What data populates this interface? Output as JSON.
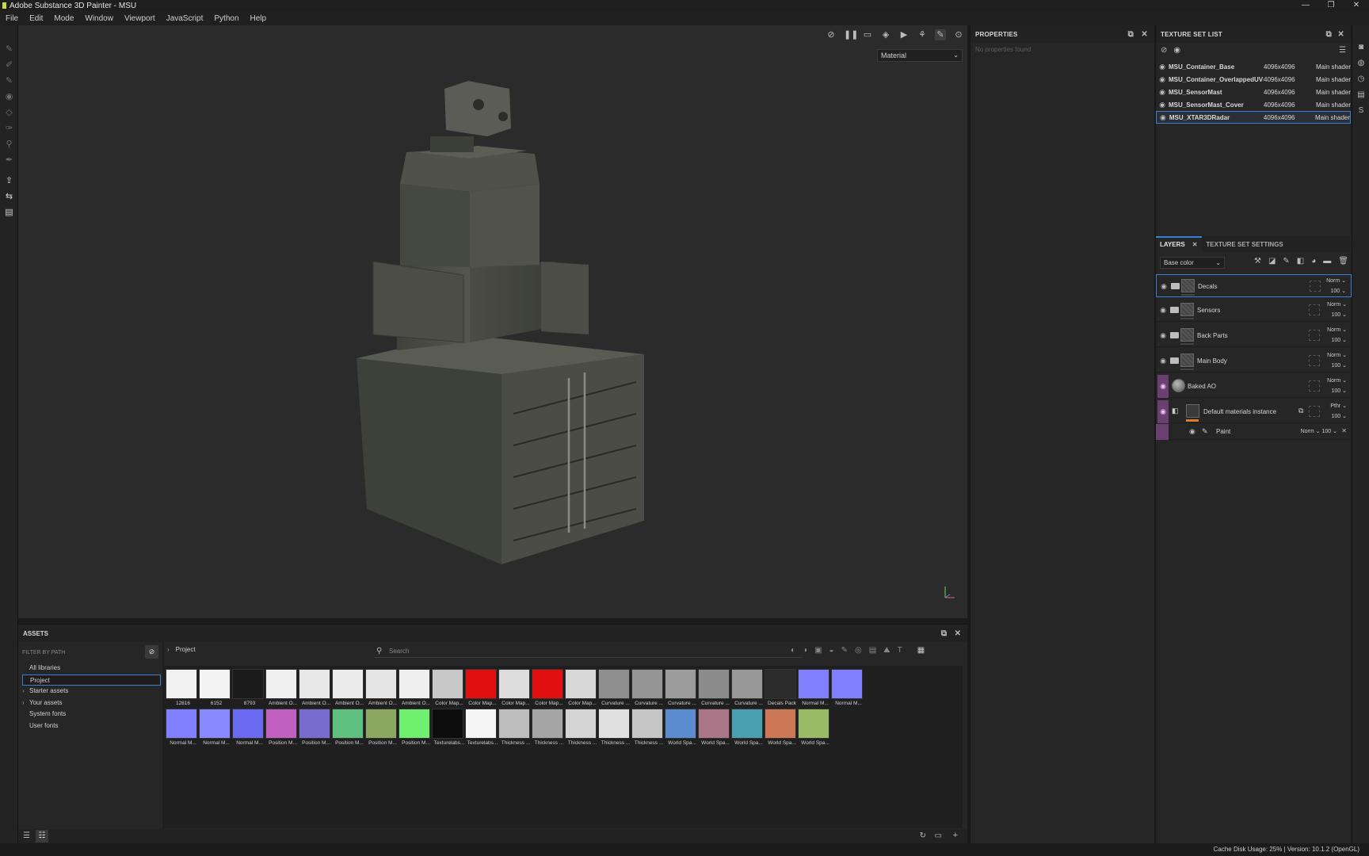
{
  "window": {
    "title": "Adobe Substance 3D Painter - MSU"
  },
  "menu": [
    "File",
    "Edit",
    "Mode",
    "Window",
    "Viewport",
    "JavaScript",
    "Python",
    "Help"
  ],
  "viewport": {
    "material_select": "Material"
  },
  "properties": {
    "title": "PROPERTIES",
    "empty": "No properties found"
  },
  "texture_set_list": {
    "title": "TEXTURE SET LIST",
    "rows": [
      {
        "name": "MSU_Container_Base",
        "res": "4096x4096",
        "shader": "Main shader"
      },
      {
        "name": "MSU_Container_OverlappedUVs",
        "res": "4096x4096",
        "shader": "Main shader"
      },
      {
        "name": "MSU_SensorMast",
        "res": "4096x4096",
        "shader": "Main shader"
      },
      {
        "name": "MSU_SensorMast_Cover",
        "res": "4096x4096",
        "shader": "Main shader"
      },
      {
        "name": "MSU_XTAR3DRadar",
        "res": "4096x4096",
        "shader": "Main shader"
      }
    ]
  },
  "layers": {
    "tab_layers": "LAYERS",
    "tab_settings": "TEXTURE SET SETTINGS",
    "channel": "Base color",
    "items": [
      {
        "name": "Decals",
        "blend": "Norm",
        "opacity": "100"
      },
      {
        "name": "Sensors",
        "blend": "Norm",
        "opacity": "100"
      },
      {
        "name": "Back Parts",
        "blend": "Norm",
        "opacity": "100"
      },
      {
        "name": "Main Body",
        "blend": "Norm",
        "opacity": "100"
      },
      {
        "name": "Baked AO",
        "blend": "Norm",
        "opacity": "100"
      },
      {
        "name": "Default materials instance",
        "blend": "Pthr",
        "opacity": "100"
      }
    ],
    "sub": {
      "name": "Paint",
      "blend": "Norm",
      "opacity": "100"
    }
  },
  "assets": {
    "title": "ASSETS",
    "filter_label": "FILTER BY PATH",
    "breadcrumb": "Project",
    "search_placeholder": "Search",
    "libraries": [
      "All libraries",
      "Project",
      "Starter assets",
      "Your assets",
      "System fonts",
      "User fonts"
    ],
    "row1": [
      "12816",
      "6152",
      "8793",
      "Ambient O...",
      "Ambient O...",
      "Ambient O...",
      "Ambient O...",
      "Ambient O...",
      "Color Map...",
      "Color Map...",
      "Color Map...",
      "Color Map...",
      "Color Map...",
      "Curvature ...",
      "Curvature ...",
      "Curvature ...",
      "Curvature ...",
      "Curvature ...",
      "Decals Pack",
      "Normal M...",
      "Normal M..."
    ],
    "row2": [
      "Normal M...",
      "Normal M...",
      "Normal M...",
      "Position M...",
      "Position M...",
      "Position M...",
      "Position M...",
      "Position M...",
      "Texturelabs...",
      "Texturelabs...",
      "Thickness ...",
      "Thickness ...",
      "Thickness ...",
      "Thickness ...",
      "Thickness ...",
      "World Spa...",
      "World Spa...",
      "World Spa...",
      "World Spa...",
      "World Spa..."
    ]
  },
  "status": "Cache Disk Usage:   25% | Version: 10.1.2 (OpenGL)"
}
